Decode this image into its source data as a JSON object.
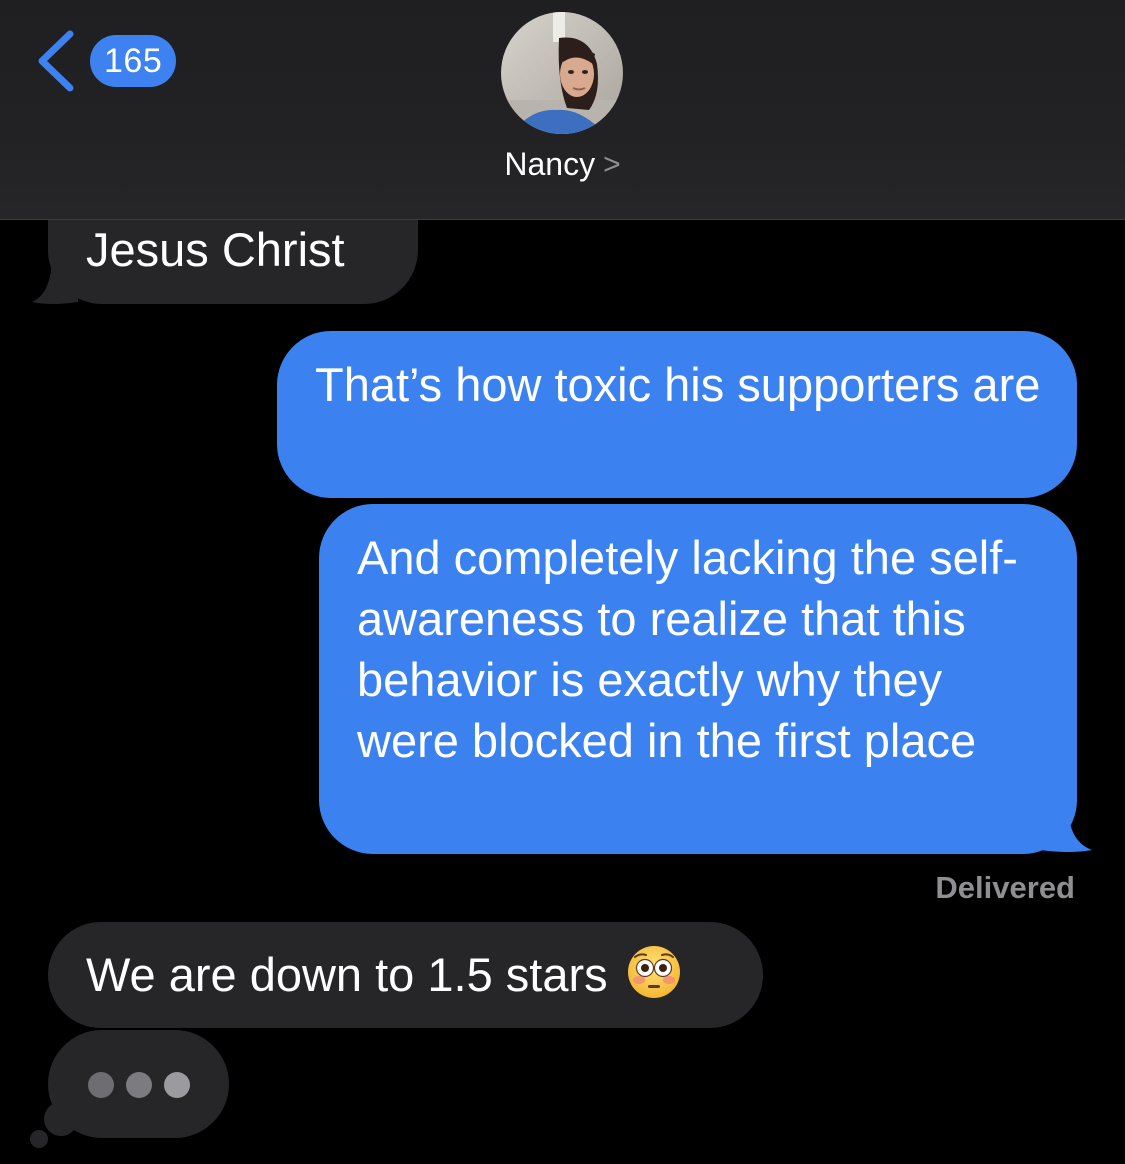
{
  "header": {
    "back_badge_count": "165",
    "contact_name": "Nancy",
    "name_chevron": ">"
  },
  "messages": [
    {
      "direction": "incoming",
      "text": "Jesus Christ"
    },
    {
      "direction": "outgoing",
      "text": "That’s how toxic his supporters are"
    },
    {
      "direction": "outgoing",
      "text": "And completely lacking the self-awareness to realize that this behavior is exactly why they were blocked in the first place"
    },
    {
      "direction": "incoming",
      "text": "We are down to 1.5 stars",
      "emoji": "flushed-face"
    }
  ],
  "status": {
    "delivered_label": "Delivered"
  },
  "typing_indicator": {
    "visible": true
  },
  "colors": {
    "outgoing_bubble": "#3b82f0",
    "incoming_bubble": "#262629",
    "badge": "#3d82f0",
    "background": "#000000",
    "header": "#222224"
  }
}
